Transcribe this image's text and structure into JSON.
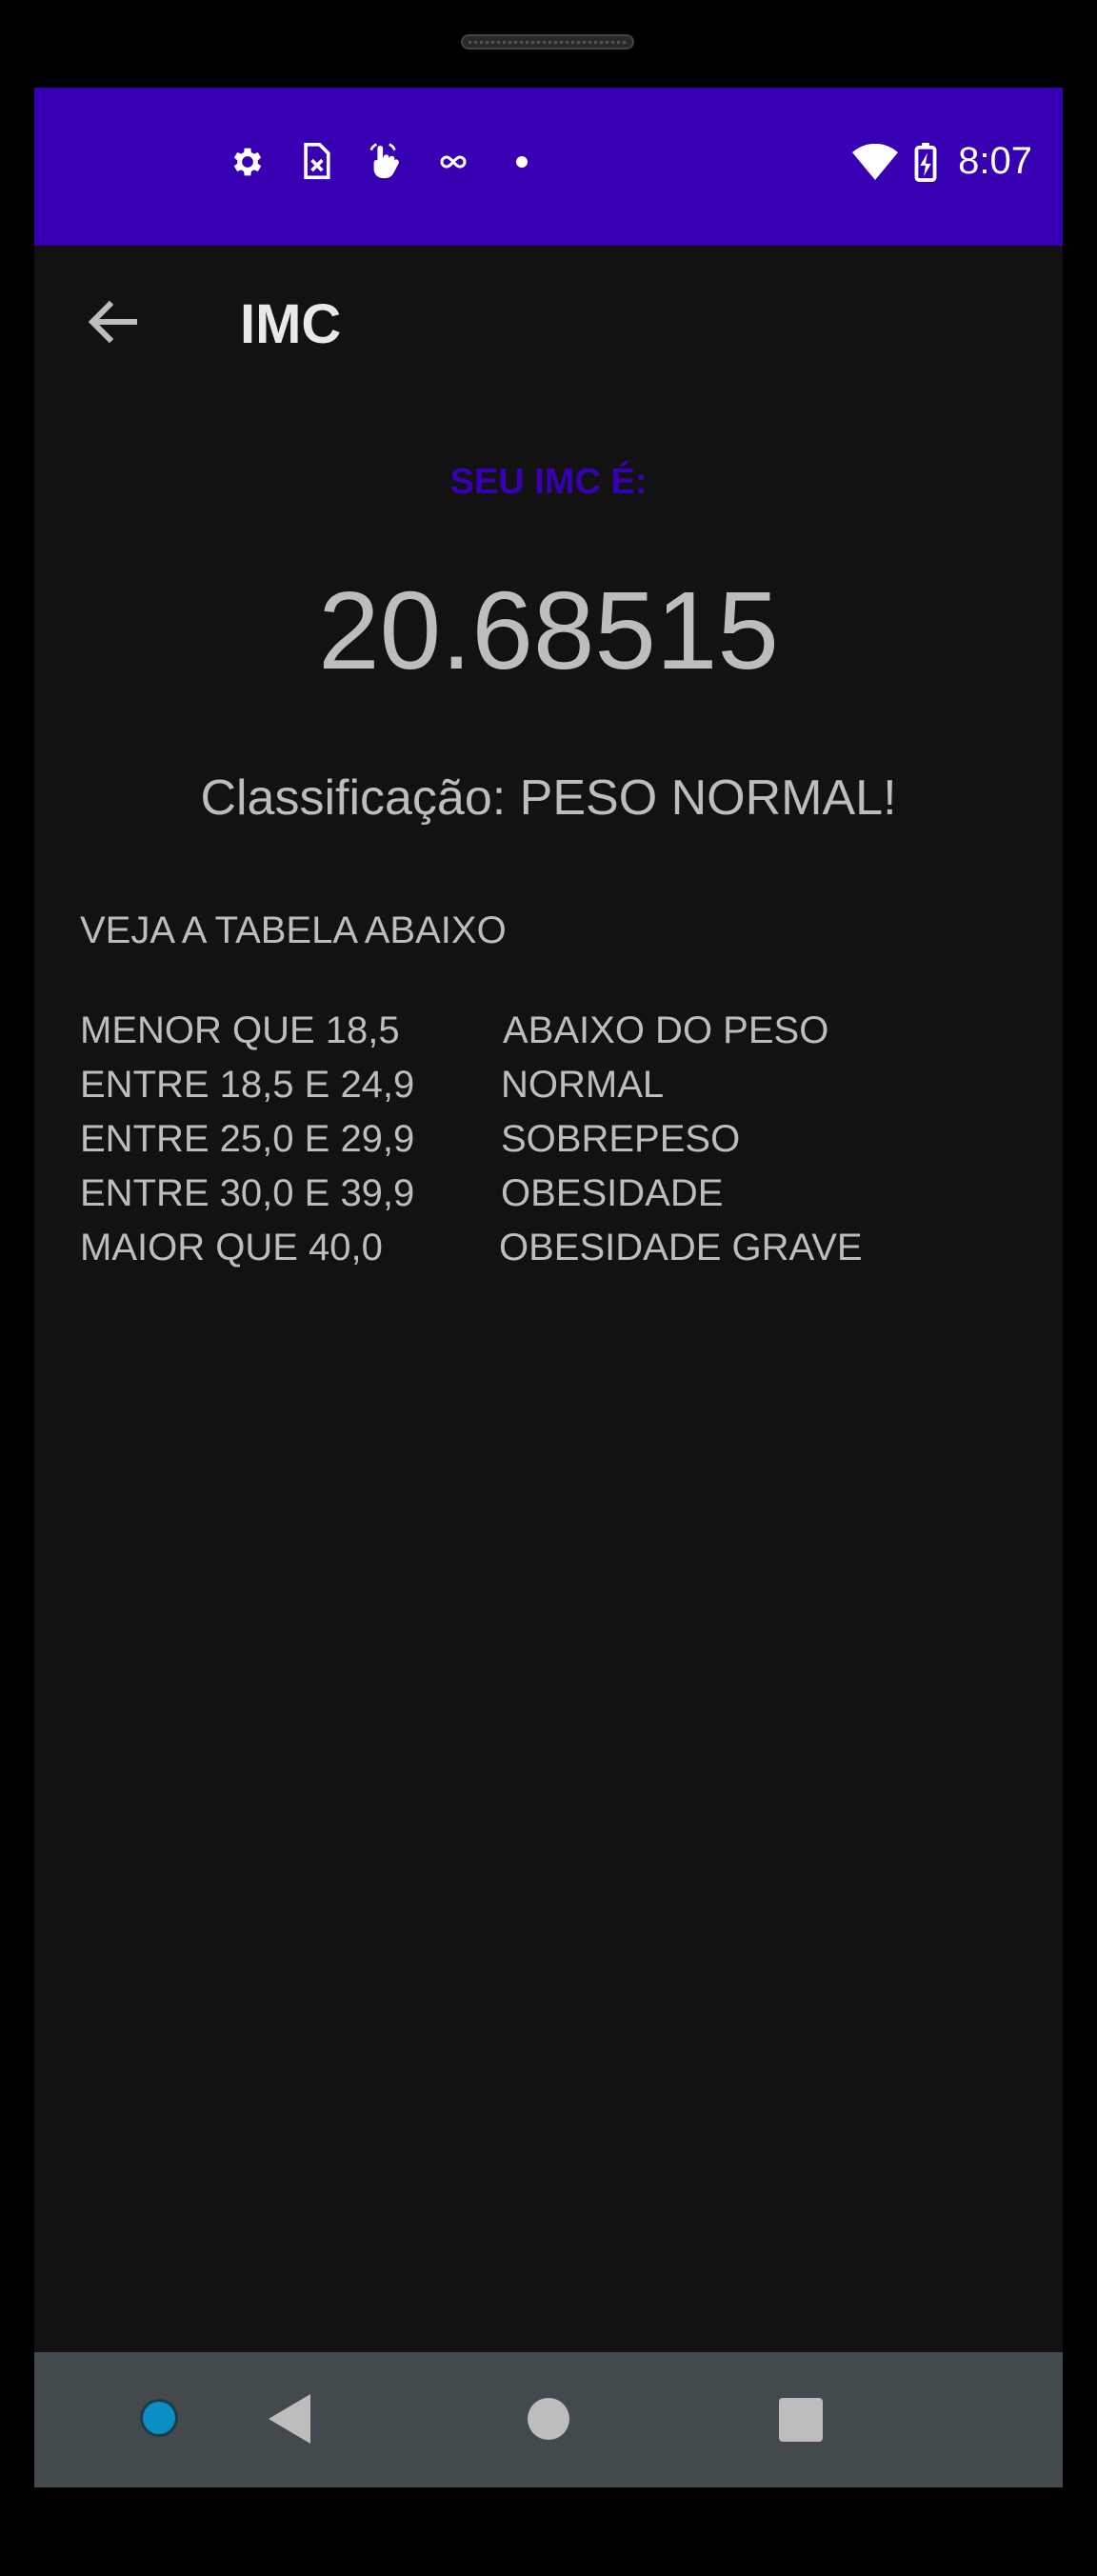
{
  "status_bar": {
    "background": "#3700b3",
    "left_icons": [
      "gear-icon",
      "sim-card-x-icon",
      "touch-hand-icon",
      "infinity-icon",
      "dot-icon"
    ],
    "right_icons": [
      "wifi-icon",
      "battery-charging-icon"
    ],
    "time": "8:07"
  },
  "app_bar": {
    "back_icon": "arrow-left-icon",
    "title": "IMC"
  },
  "result": {
    "label": "SEU IMC É:",
    "label_color": "#3700b3",
    "value": "20.68515",
    "classification_prefix": "Classificação: ",
    "classification_value": "PESO NORMAL!"
  },
  "table": {
    "intro": "VEJA A TABELA ABAIXO",
    "rows": [
      {
        "range": "MENOR QUE 18,5",
        "category": "ABAIXO DO PESO"
      },
      {
        "range": "ENTRE 18,5 E 24,9",
        "category": "NORMAL"
      },
      {
        "range": "ENTRE 25,0 E 29,9",
        "category": "SOBREPESO"
      },
      {
        "range": "ENTRE 30,0 E 39,9",
        "category": "OBESIDADE"
      },
      {
        "range": "MAIOR QUE 40,0",
        "category": "OBESIDADE GRAVE"
      }
    ]
  },
  "nav_bar": {
    "icons": [
      "assistant-dot-icon",
      "back-triangle-icon",
      "home-circle-icon",
      "recents-square-icon"
    ]
  }
}
